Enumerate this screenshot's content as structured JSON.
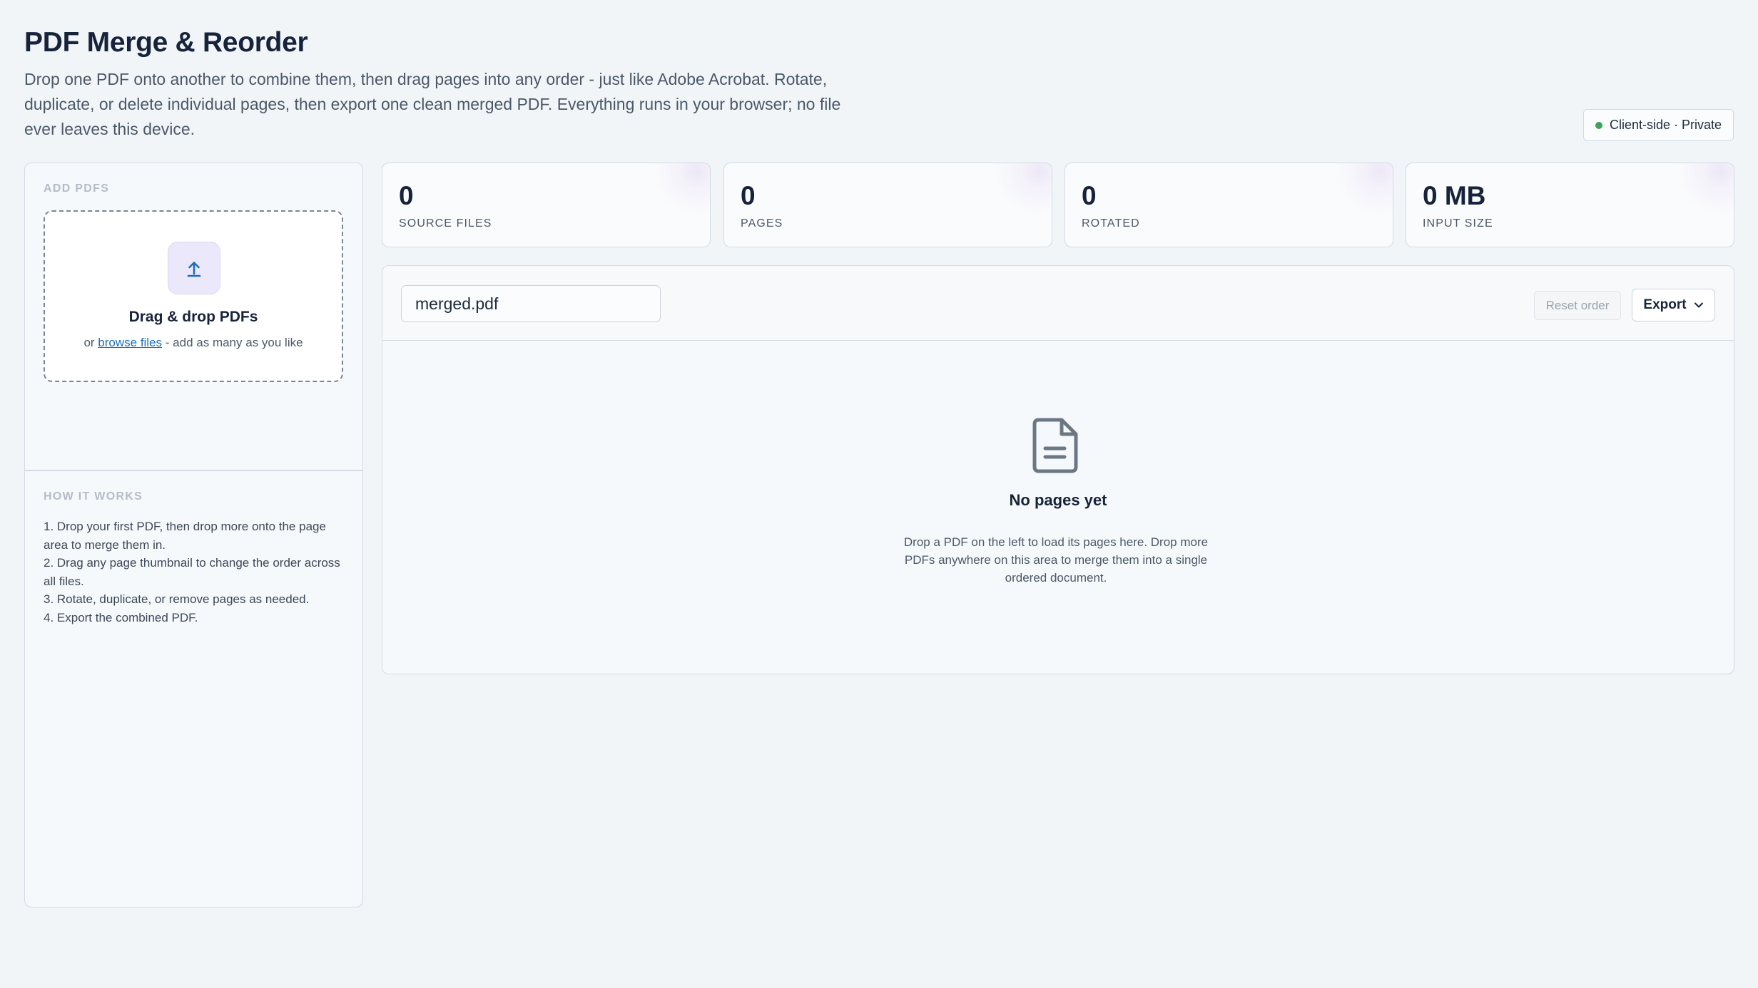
{
  "header": {
    "title": "PDF Merge & Reorder",
    "description": "Drop one PDF onto another to combine them, then drag pages into any order - just like Adobe Acrobat. Rotate, duplicate, or delete individual pages, then export one clean merged PDF. Everything runs in your browser; no file ever leaves this device.",
    "privacy_badge": "Client-side · Private",
    "status_color": "#3fa15a"
  },
  "sidebar": {
    "add_label": "ADD PDFS",
    "dropzone": {
      "title": "Drag & drop PDFs",
      "prefix": "or",
      "link": "browse files",
      "suffix": "- add as many as you like",
      "icon": "upload-icon"
    },
    "how_label": "HOW IT WORKS",
    "steps": [
      "1. Drop your first PDF, then drop more onto the page area to merge them in.",
      "2. Drag any page thumbnail to change the order across all files.",
      "3. Rotate, duplicate, or remove pages as needed.",
      "4. Export the combined PDF."
    ]
  },
  "stats": [
    {
      "value": "0",
      "label": "SOURCE FILES"
    },
    {
      "value": "0",
      "label": "PAGES"
    },
    {
      "value": "0",
      "label": "ROTATED"
    },
    {
      "value": "0 MB",
      "label": "INPUT SIZE"
    }
  ],
  "toolbar": {
    "filename_value": "merged.pdf",
    "reset_label": "Reset order",
    "export_label": "Export"
  },
  "empty_state": {
    "icon": "document-icon",
    "title": "No pages yet",
    "description": "Drop a PDF on the left to load its pages here. Drop more PDFs anywhere on this area to merge them into a single ordered document."
  },
  "colors": {
    "accent": "#1d6fb8",
    "upload_tile": "#ece8fb"
  }
}
